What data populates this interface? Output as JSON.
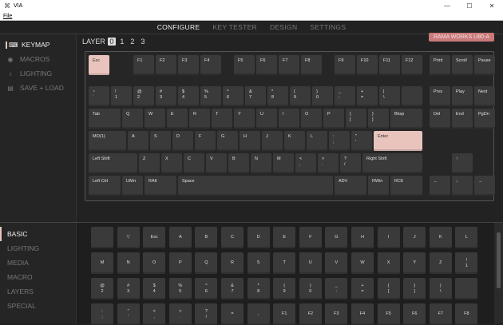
{
  "window": {
    "title": "VIA",
    "minimize": "—",
    "maximize": "☐",
    "close": "✕"
  },
  "menubar": {
    "file": "File"
  },
  "nav": {
    "tabs": [
      {
        "label": "CONFIGURE",
        "active": true
      },
      {
        "label": "KEY TESTER",
        "active": false
      },
      {
        "label": "DESIGN",
        "active": false
      },
      {
        "label": "SETTINGS",
        "active": false
      }
    ]
  },
  "sidebar": {
    "items": [
      {
        "label": "KEYMAP",
        "icon": "keyboard-icon",
        "glyph": "⌨",
        "active": true
      },
      {
        "label": "MACROS",
        "icon": "circle-dot-icon",
        "glyph": "◉",
        "active": false
      },
      {
        "label": "LIGHTING",
        "icon": "lightbulb-icon",
        "glyph": "♁",
        "active": false
      },
      {
        "label": "SAVE + LOAD",
        "icon": "floppy-icon",
        "glyph": "▤",
        "active": false
      }
    ],
    "categories": [
      {
        "label": "BASIC",
        "active": true
      },
      {
        "label": "LIGHTING",
        "active": false
      },
      {
        "label": "MEDIA",
        "active": false
      },
      {
        "label": "MACRO",
        "active": false
      },
      {
        "label": "LAYERS",
        "active": false
      },
      {
        "label": "SPECIAL",
        "active": false
      }
    ]
  },
  "layers": {
    "label": "LAYER",
    "items": [
      "0",
      "1",
      "2",
      "3"
    ],
    "selected": 0
  },
  "keyboard": {
    "name": "RAMA WORKS U80-A"
  },
  "keys": [
    {
      "t": "Esc",
      "hl": true
    },
    {
      "t": "F1"
    },
    {
      "t": "F2"
    },
    {
      "t": "F3"
    },
    {
      "t": "F4"
    },
    {
      "t": "F5"
    },
    {
      "t": "F6"
    },
    {
      "t": "F7"
    },
    {
      "t": "F8"
    },
    {
      "t": "F9"
    },
    {
      "t": "F10"
    },
    {
      "t": "F11"
    },
    {
      "t": "F12"
    },
    {
      "t": "Print"
    },
    {
      "t": "Scroll"
    },
    {
      "t": "Pause"
    },
    {
      "t": "~\n`"
    },
    {
      "t": "!\n1"
    },
    {
      "t": "@\n2"
    },
    {
      "t": "#\n3"
    },
    {
      "t": "$\n4"
    },
    {
      "t": "%\n5"
    },
    {
      "t": "^\n6"
    },
    {
      "t": "&\n7"
    },
    {
      "t": "*\n8"
    },
    {
      "t": "(\n9"
    },
    {
      "t": ")\n0"
    },
    {
      "t": "_\n-"
    },
    {
      "t": "+\n="
    },
    {
      "t": "|\n\\"
    },
    {
      "t": ""
    },
    {
      "t": "Prvs"
    },
    {
      "t": "Play"
    },
    {
      "t": "Next"
    },
    {
      "t": "Tab"
    },
    {
      "t": "Q"
    },
    {
      "t": "W"
    },
    {
      "t": "E"
    },
    {
      "t": "R"
    },
    {
      "t": "T"
    },
    {
      "t": "Y"
    },
    {
      "t": "U"
    },
    {
      "t": "I"
    },
    {
      "t": "O"
    },
    {
      "t": "P"
    },
    {
      "t": "{\n["
    },
    {
      "t": "}\n]"
    },
    {
      "t": "Bksp"
    },
    {
      "t": "Del"
    },
    {
      "t": "End"
    },
    {
      "t": "PgDn"
    },
    {
      "t": "MO(1)"
    },
    {
      "t": "A"
    },
    {
      "t": "S"
    },
    {
      "t": "D"
    },
    {
      "t": "F"
    },
    {
      "t": "G"
    },
    {
      "t": "H"
    },
    {
      "t": "J"
    },
    {
      "t": "K"
    },
    {
      "t": "L"
    },
    {
      "t": ":\n;"
    },
    {
      "t": "\"\n'"
    },
    {
      "t": "Enter",
      "hl": true
    },
    {
      "t": "Left Shift"
    },
    {
      "t": "Z"
    },
    {
      "t": "X"
    },
    {
      "t": "C"
    },
    {
      "t": "V"
    },
    {
      "t": "B"
    },
    {
      "t": "N"
    },
    {
      "t": "M"
    },
    {
      "t": "<\n,"
    },
    {
      "t": ">\n."
    },
    {
      "t": "?\n/"
    },
    {
      "t": "Right Shift"
    },
    {
      "t": "↑"
    },
    {
      "t": "Left Ctrl"
    },
    {
      "t": "LWin"
    },
    {
      "t": "RAlt"
    },
    {
      "t": "Space"
    },
    {
      "t": "ADV"
    },
    {
      "t": "RWin"
    },
    {
      "t": "RCtl"
    },
    {
      "t": "←"
    },
    {
      "t": "↓"
    },
    {
      "t": "→"
    }
  ],
  "basic_keys": [
    "",
    "▽",
    "Esc",
    "A",
    "B",
    "C",
    "D",
    "E",
    "F",
    "G",
    "H",
    "I",
    "J",
    "K",
    "L",
    "M",
    "N",
    "O",
    "P",
    "Q",
    "R",
    "S",
    "T",
    "U",
    "V",
    "W",
    "X",
    "Y",
    "Z",
    "!\n1",
    "@\n2",
    "#\n3",
    "$\n4",
    "%\n5",
    "^\n6",
    "&\n7",
    "*\n8",
    "(\n9",
    ")\n0",
    "_\n-",
    "+\n=",
    "{\n[",
    "}\n]",
    "|\n\\",
    "",
    ":\n;",
    "\"\n'",
    "<\n,",
    ">\n.",
    "?\n/",
    "=",
    ",",
    "F1",
    "F2",
    "F3",
    "F4",
    "F5",
    "F6",
    "F7",
    "F8"
  ]
}
